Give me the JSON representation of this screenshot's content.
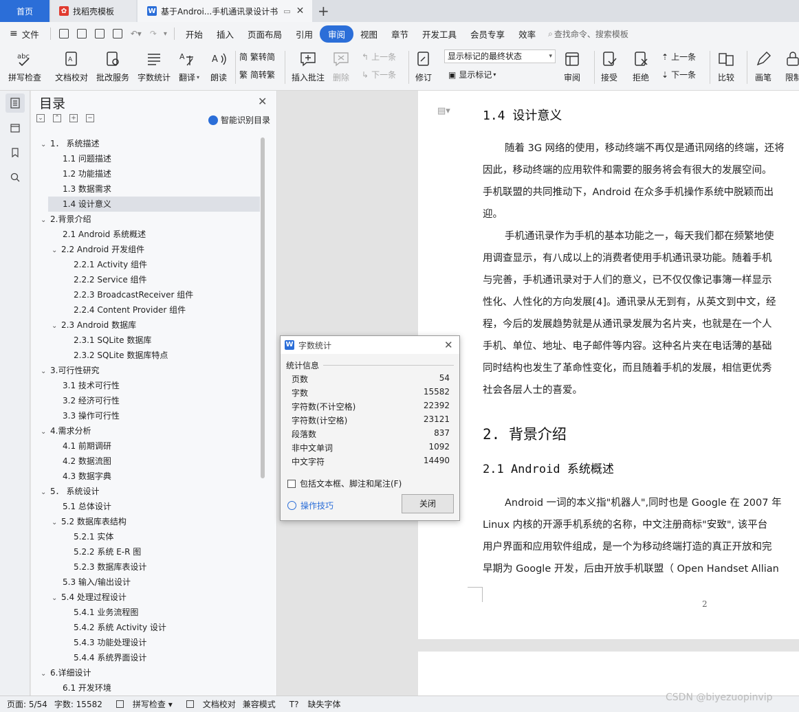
{
  "tabs": [
    {
      "label": "首页"
    },
    {
      "label": "找稻壳模板"
    },
    {
      "label": "基于Androi...手机通讯录设计书"
    }
  ],
  "menu": [
    "文件",
    "开始",
    "插入",
    "页面布局",
    "引用",
    "审阅",
    "视图",
    "章节",
    "开发工具",
    "会员专享",
    "效率"
  ],
  "menu_active": "审阅",
  "search_placeholder": "查找命令、搜索模板",
  "ribbon": {
    "spell": "拼写检查",
    "proof": "文档校对",
    "annotate": "批改服务",
    "wordcount": "字数统计",
    "translate": "翻译",
    "read": "朗读",
    "trad": "繁转简",
    "simp": "简转繁",
    "insert_comment": "插入批注",
    "delete": "删除",
    "prev": "上一条",
    "next": "下一条",
    "revise": "修订",
    "markup_state": "显示标记的最终状态",
    "show_markup": "显示标记",
    "review": "审阅",
    "accept": "接受",
    "reject": "拒绝",
    "prev2": "上一条",
    "next2": "下一条",
    "compare": "比较",
    "pen": "画笔",
    "limit": "限制"
  },
  "toc": {
    "title": "目录",
    "smart": "智能识别目录",
    "items": [
      {
        "label": "1． 系统描述",
        "level": 0,
        "arrow": true
      },
      {
        "label": "1.1  问题描述",
        "level": 1
      },
      {
        "label": "1.2  功能描述",
        "level": 1
      },
      {
        "label": "1.3  数据需求",
        "level": 1
      },
      {
        "label": "1.4  设计意义",
        "level": 1,
        "selected": true
      },
      {
        "label": "2.背景介绍",
        "level": 0,
        "arrow": true
      },
      {
        "label": "2.1 Android 系统概述",
        "level": 1
      },
      {
        "label": "2.2 Android 开发组件",
        "level": 1,
        "arrow": true
      },
      {
        "label": "2.2.1 Activity 组件",
        "level": 2
      },
      {
        "label": "2.2.2 Service  组件",
        "level": 2
      },
      {
        "label": "2.2.3 BroadcastReceiver  组件",
        "level": 2
      },
      {
        "label": "2.2.4 Content Provider  组件",
        "level": 2
      },
      {
        "label": "2.3 Android 数据库",
        "level": 1,
        "arrow": true
      },
      {
        "label": "2.3.1 SQLite 数据库",
        "level": 2
      },
      {
        "label": "2.3.2 SQLite 数据库特点",
        "level": 2
      },
      {
        "label": "3.可行性研究",
        "level": 0,
        "arrow": true
      },
      {
        "label": "3.1  技术可行性",
        "level": 1
      },
      {
        "label": "3.2  经济可行性",
        "level": 1
      },
      {
        "label": "3.3  操作可行性",
        "level": 1
      },
      {
        "label": "4.需求分析",
        "level": 0,
        "arrow": true
      },
      {
        "label": "4.1  前期调研",
        "level": 1
      },
      {
        "label": "4.2  数据流图",
        "level": 1
      },
      {
        "label": "4.3  数据字典",
        "level": 1
      },
      {
        "label": "5． 系统设计",
        "level": 0,
        "arrow": true
      },
      {
        "label": "5.1  总体设计",
        "level": 1
      },
      {
        "label": "5.2  数据库表结构",
        "level": 1,
        "arrow": true
      },
      {
        "label": "5.2.1  实体",
        "level": 2
      },
      {
        "label": "5.2.2  系统 E-R 图",
        "level": 2
      },
      {
        "label": "5.2.3  数据库表设计",
        "level": 2
      },
      {
        "label": "5.3  输入/输出设计",
        "level": 1
      },
      {
        "label": "5.4  处理过程设计",
        "level": 1,
        "arrow": true
      },
      {
        "label": "5.4.1  业务流程图",
        "level": 2
      },
      {
        "label": "5.4.2  系统 Activity 设计",
        "level": 2
      },
      {
        "label": "5.4.3  功能处理设计",
        "level": 2
      },
      {
        "label": "5.4.4  系统界面设计",
        "level": 2
      },
      {
        "label": "6.详细设计",
        "level": 0,
        "arrow": true
      },
      {
        "label": "6.1  开发环境",
        "level": 1
      }
    ]
  },
  "doc": {
    "h14": "1.4 设计意义",
    "p1": [
      "随着 3G 网络的使用，移动终端不再仅是通讯网络的终端，还将",
      "因此，移动终端的应用软件和需要的服务将会有很大的发展空间。",
      "手机联盟的共同推动下，Android 在众多手机操作系统中脱颖而出",
      "迎。"
    ],
    "p2": [
      "手机通讯录作为手机的基本功能之一，每天我们都在频繁地使",
      "用调查显示，有八成以上的消费者使用手机通讯录功能。随着手机",
      "与完善，手机通讯录对于人们的意义，已不仅仅像记事簿一样显示",
      "性化、人性化的方向发展[4]。通讯录从无到有，从英文到中文，经",
      "程，今后的发展趋势就是从通讯录发展为名片夹，也就是在一个人",
      "手机、单位、地址、电子邮件等内容。这种名片夹在电话薄的基础",
      "同时结构也发生了革命性变化，而且随着手机的发展，相信更优秀",
      "社会各层人士的喜爱。"
    ],
    "h2": "2. 背景介绍",
    "h21": "2.1 Android 系统概述",
    "p3": [
      "Android 一词的本义指\"机器人\",同时也是 Google 在 2007 年",
      "Linux 内核的开源手机系统的名称，中文注册商标\"安致\",  该平台",
      "用户界面和应用软件组成，是一个为移动终端打造的真正开放和完",
      "早期为 Google 开发，后由开放手机联盟（ Open Handset Allian"
    ],
    "page_num": "2"
  },
  "dialog": {
    "title": "字数统计",
    "group": "统计信息",
    "stats": [
      {
        "label": "页数",
        "value": "54"
      },
      {
        "label": "字数",
        "value": "15582"
      },
      {
        "label": "字符数(不计空格)",
        "value": "22392"
      },
      {
        "label": "字符数(计空格)",
        "value": "23121"
      },
      {
        "label": "段落数",
        "value": "837"
      },
      {
        "label": "非中文单词",
        "value": "1092"
      },
      {
        "label": "中文字符",
        "value": "14490"
      }
    ],
    "checkbox": "包括文本框、脚注和尾注(F)",
    "tips": "操作技巧",
    "close": "关闭"
  },
  "status": {
    "page": "页面: 5/54",
    "words": "字数: 15582",
    "spell": "拼写检查",
    "proof": "文档校对",
    "compat": "兼容模式",
    "missing_font": "缺失字体"
  },
  "watermark": "CSDN @biyezuopinvip",
  "colors": {
    "accent": "#2b6ed8",
    "tab_red": "#e03a2f"
  }
}
